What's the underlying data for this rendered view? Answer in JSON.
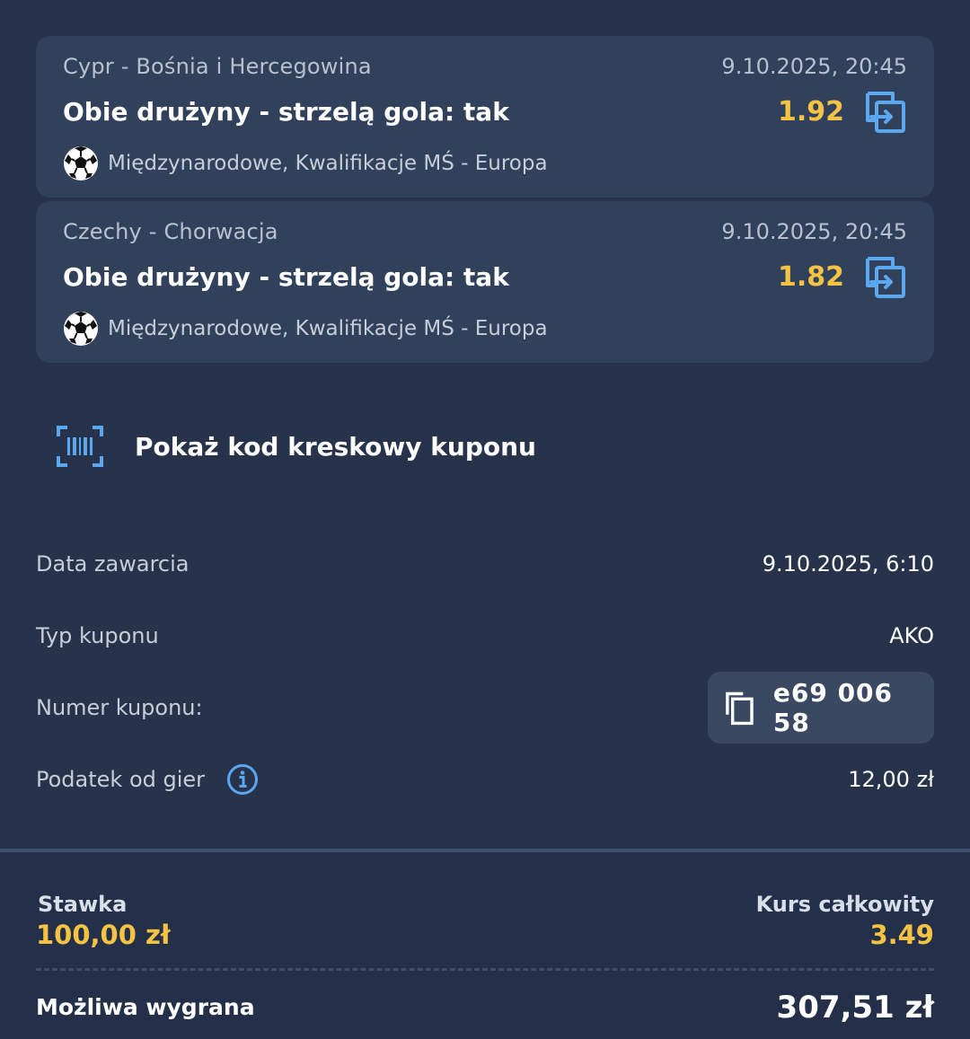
{
  "bets": [
    {
      "match": "Cypr - Bośnia i Hercegowina",
      "date": "9.10.2025, 20:45",
      "selection": "Obie drużyny - strzelą gola: tak",
      "odds": "1.92",
      "league": "Międzynarodowe, Kwalifikacje MŚ - Europa"
    },
    {
      "match": "Czechy - Chorwacja",
      "date": "9.10.2025, 20:45",
      "selection": "Obie drużyny - strzelą gola: tak",
      "odds": "1.82",
      "league": "Międzynarodowe, Kwalifikacje MŚ - Europa"
    }
  ],
  "barcode": {
    "label": "Pokaż kod kreskowy kuponu"
  },
  "details": {
    "date_label": "Data zawarcia",
    "date_value": "9.10.2025, 6:10",
    "type_label": "Typ kuponu",
    "type_value": "AKO",
    "number_label": "Numer kuponu:",
    "number_value": "e69 006 58",
    "tax_label": "Podatek od gier",
    "tax_value": "12,00 zł"
  },
  "summary": {
    "stake_label": "Stawka",
    "stake_value": "100,00 zł",
    "total_odds_label": "Kurs całkowity",
    "total_odds_value": "3.49",
    "win_label": "Możliwa wygrana",
    "win_value": "307,51 zł"
  },
  "icons": {
    "swap": "swap-bet-icon",
    "ball": "soccer-ball-icon",
    "barcode": "barcode-icon",
    "copy": "copy-icon",
    "info": "info-icon"
  },
  "colors": {
    "background": "#26334a",
    "card": "#31405b",
    "accent_odds": "#f5c343",
    "icon_blue": "#5ba7f0"
  }
}
